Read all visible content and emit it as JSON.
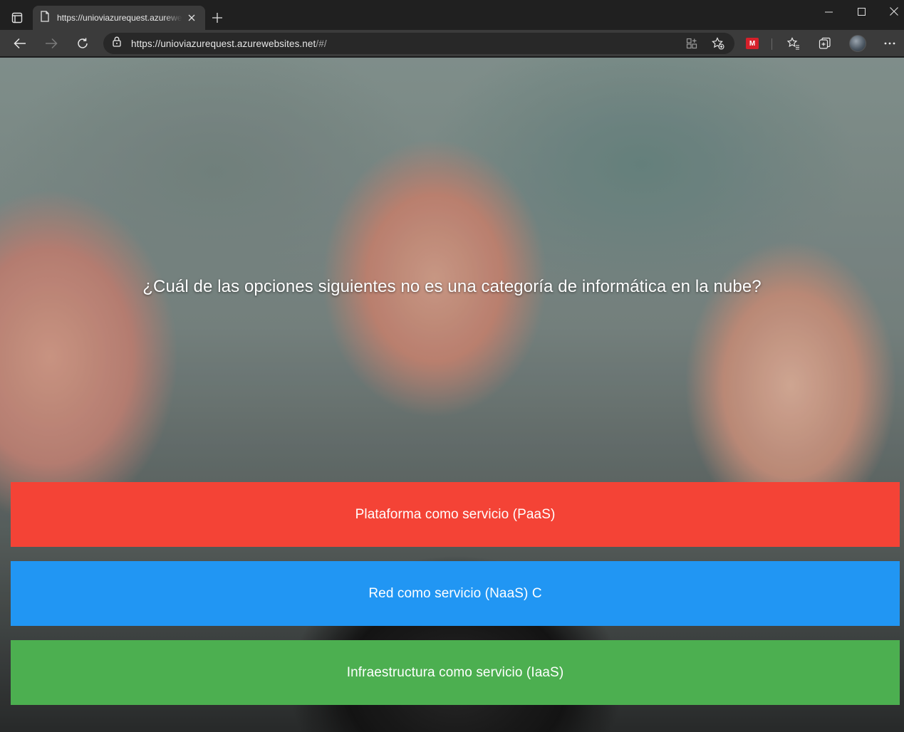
{
  "browser": {
    "tab": {
      "title": "https://unioviazurequest.azurewebsites.net/#/",
      "favicon": "page-icon"
    },
    "address": {
      "host": "https://unioviazurequest.azurewebsites.net",
      "path": "/#/"
    },
    "extension": {
      "badge": "M",
      "color": "#d6202a"
    }
  },
  "quiz": {
    "question": "¿Cuál de las opciones siguientes no es una categoría de informática en la nube?",
    "answers": [
      {
        "label": "Plataforma como servicio (PaaS)",
        "color": "#f44336"
      },
      {
        "label": "Red como servicio (NaaS) C",
        "color": "#2196f3"
      },
      {
        "label": "Infraestructura como servicio (IaaS)",
        "color": "#4caf50"
      }
    ]
  }
}
